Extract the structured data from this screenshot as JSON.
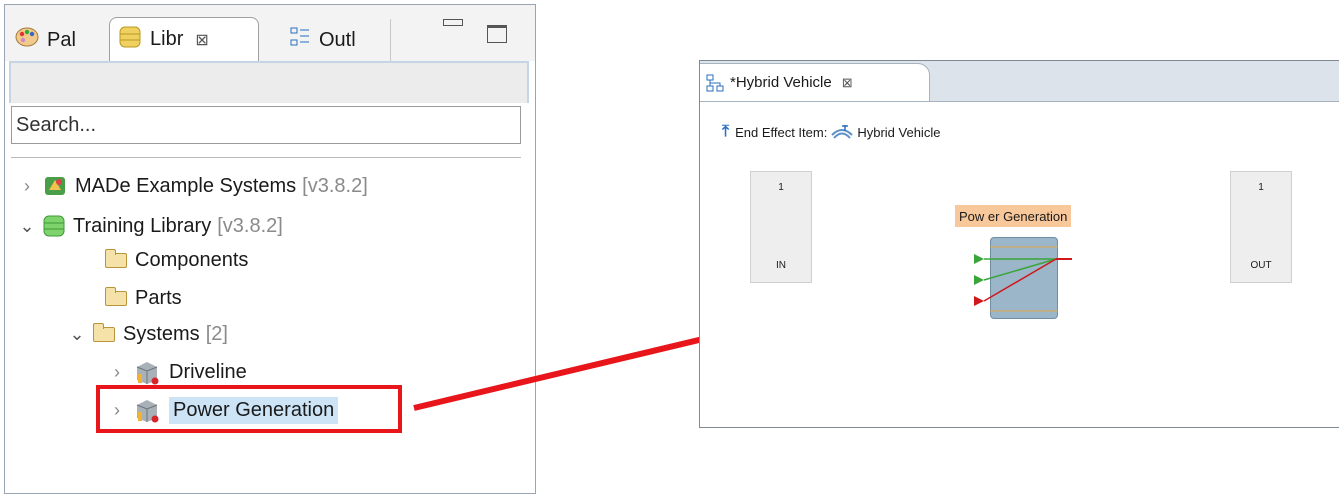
{
  "library_view": {
    "tabs": [
      {
        "label": "Pal",
        "icon": "palette-icon"
      },
      {
        "label": "Libr",
        "icon": "library-icon",
        "close": "⊠"
      },
      {
        "label": "Outl",
        "icon": "outline-icon"
      }
    ],
    "search": {
      "placeholder": "Search..."
    },
    "tree": [
      {
        "label": "MADe Example Systems",
        "version": "[v3.8.2]"
      },
      {
        "label": "Training Library",
        "version": "[v3.8.2]"
      },
      {
        "label": "Components"
      },
      {
        "label": "Parts"
      },
      {
        "label": "Systems",
        "count": "[2]"
      },
      {
        "label": "Driveline"
      },
      {
        "label": "Power Generation"
      }
    ]
  },
  "editor": {
    "tab_title": "*Hybrid Vehicle",
    "tab_close": "⊠",
    "end_effect_label": "End Effect Item:",
    "end_effect_value": "Hybrid Vehicle",
    "in_port": {
      "number": "1",
      "label": "IN"
    },
    "out_port": {
      "number": "1",
      "label": "OUT"
    },
    "component_label": "Pow er Generation"
  },
  "colors": {
    "highlight": "#e8161b",
    "selection": "#cde4f7",
    "component_fill": "#9bb5c9",
    "component_label_bg": "#f9c89a",
    "flow_green": "#3aa53a",
    "flow_red": "#d0181c"
  }
}
